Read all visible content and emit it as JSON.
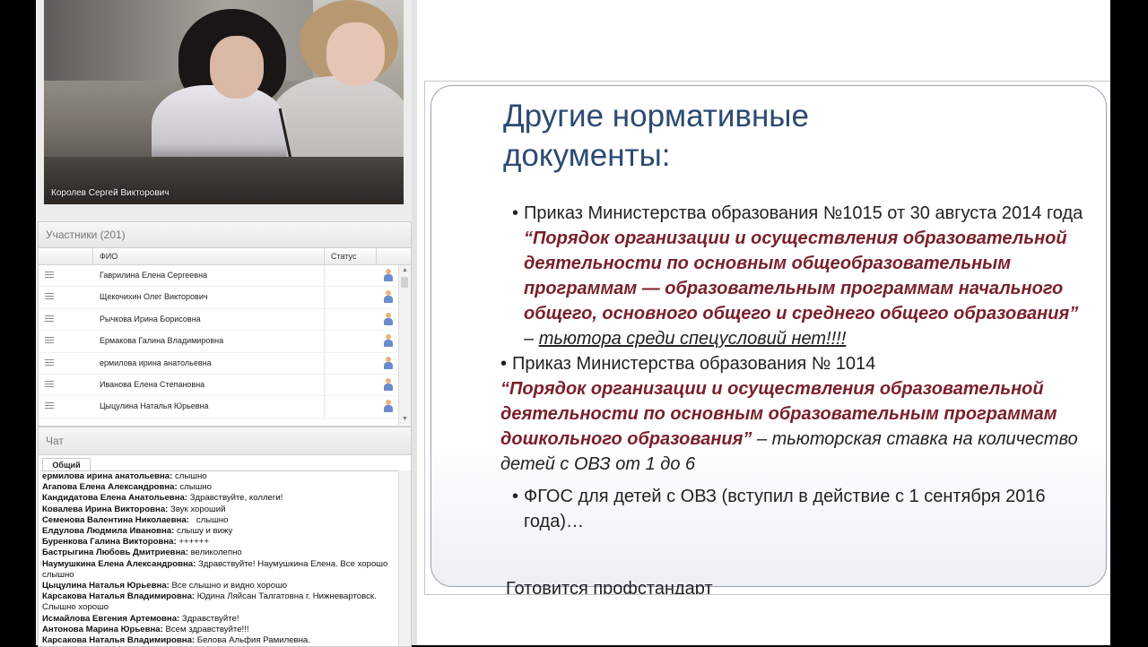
{
  "video": {
    "speaker_name": "Королев Сергей Викторович"
  },
  "participants": {
    "title": "Участники (201)",
    "col_fio": "ФИО",
    "col_status": "Статус",
    "rows": [
      "Гаврилина Елена Сергеевна",
      "Щекочихин Олег Викторович",
      "Рычкова Ирина Борисовна",
      "Ермакова Галина Владимировна",
      "ермилова ирина анатольевна",
      "Иванова Елена Степановна",
      "Цыцулина Наталья Юрьевна"
    ]
  },
  "chat": {
    "title": "Чат",
    "tab": "Общий",
    "messages": [
      {
        "author": "ермилова ирина анатольевна:",
        "text": " слышно"
      },
      {
        "author": "Агапова Елена Александровна:",
        "text": " слышно"
      },
      {
        "author": "Кандидатова Елена Анатольевна:",
        "text": " Здравствуйте, коллеги!"
      },
      {
        "author": "Ковалева Ирина Викторовна:",
        "text": " Звук хороший"
      },
      {
        "author": "Семенова Валентина Николаевна:",
        "text": "   слышно"
      },
      {
        "author": "Елдулова Людмила Ивановна:",
        "text": " слышу и вижу"
      },
      {
        "author": "Буренкова Галина Викторовна:",
        "text": " ++++++"
      },
      {
        "author": "Бастрыгина Любовь Дмитриевна:",
        "text": " великолепно"
      },
      {
        "author": "Наумушкина Елена Александровна:",
        "text": " Здравствуйте! Наумушкина Елена. Все хорошо слышно"
      },
      {
        "author": "Цыцулина Наталья Юрьевна:",
        "text": " Все слышно и видно хорошо"
      },
      {
        "author": "Карсакова Наталья Владимировна:",
        "text": " Юдина Ляйсан Талгатовна г. Нижневартовск. Слышно хорошо"
      },
      {
        "author": "Исмайлова Евгения Артемовна:",
        "text": " Здравствуйте!"
      },
      {
        "author": "Антонова Марина Юрьевна:",
        "text": " Всем здравствуйте!!!"
      },
      {
        "author": "Карсакова Наталья Владимировна:",
        "text": " Белова Альфия Рамилевна."
      }
    ]
  },
  "slide": {
    "title": "Другие нормативные документы:",
    "b1_plain": "Приказ Министерства образования  №1015 от 30 августа 2014 года  ",
    "b1_quote": "“Порядок организации и осуществления образовательной деятельности по основным общеобразовательным программам — образовательным программам начального общего, основного общего и  среднего общего образования”",
    "b1_dash": " – ",
    "b1_under": "тьютора среди спецусловий нет!!!!",
    "b2_plain": "Приказ Министерства образования  № 1014",
    "b2_quote": "“Порядок организации и осуществления образовательной деятельности по основным образовательным программам дошкольного образования”",
    "b2_rest": " – тьюторская ставка на количество детей с ОВЗ от 1 до 6",
    "b3": "ФГОС для детей с ОВЗ (вступил в действие с 1 сентября 2016 года)…",
    "b4_partial": "Готовится профстандарт"
  }
}
